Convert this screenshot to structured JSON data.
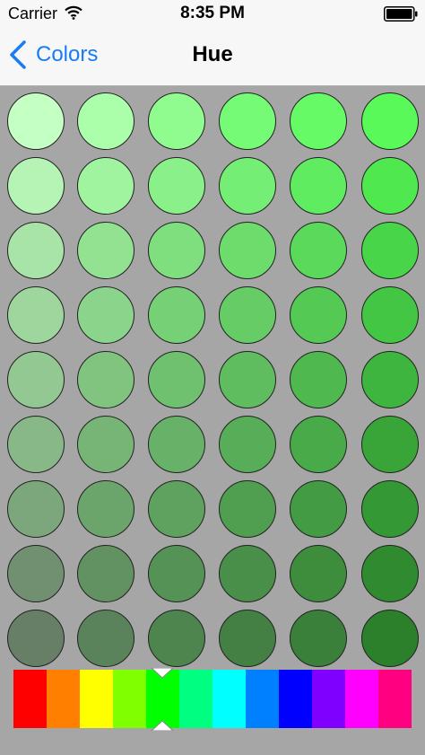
{
  "status_bar": {
    "carrier": "Carrier",
    "time": "8:35 PM",
    "wifi_icon": "wifi-icon",
    "battery_icon": "battery-icon"
  },
  "nav": {
    "back_label": "Colors",
    "back_icon": "chevron-left-icon",
    "title": "Hue",
    "accent": "#1a7cf5"
  },
  "swatch_rows": [
    [
      "#c4ffc4",
      "#abffab",
      "#90fc90",
      "#75fb75",
      "#66fa66",
      "#58f958"
    ],
    [
      "#b6f4b6",
      "#a0f4a0",
      "#8af18a",
      "#74ee74",
      "#60ec60",
      "#4fe94f"
    ],
    [
      "#a8e4a8",
      "#92e292",
      "#7fdf7f",
      "#6ddc6d",
      "#5ad95a",
      "#49d549"
    ],
    [
      "#9ed69e",
      "#8bd48b",
      "#76d076",
      "#66cd66",
      "#54ca54",
      "#43c643"
    ],
    [
      "#93c893",
      "#80c480",
      "#6fc06f",
      "#5fbd5f",
      "#4fb94f",
      "#3eb53e"
    ],
    [
      "#88b788",
      "#77b577",
      "#68b168",
      "#58ad58",
      "#49aa49",
      "#39a539"
    ],
    [
      "#7ca77c",
      "#6ca56c",
      "#5fa25f",
      "#509f50",
      "#439b43",
      "#349834"
    ],
    [
      "#718f71",
      "#629162",
      "#559255",
      "#498e49",
      "#3d8d3d",
      "#308a30"
    ],
    [
      "#677e67",
      "#5b835b",
      "#4e844e",
      "#448044",
      "#3a803a",
      "#2c802c"
    ]
  ],
  "hue_bar": {
    "colors": [
      "#ff0000",
      "#ff7f00",
      "#ffff00",
      "#7fff00",
      "#00ff00",
      "#00ff80",
      "#00ffff",
      "#0080ff",
      "#0000ff",
      "#8000ff",
      "#ff00ff",
      "#ff0080"
    ],
    "selected_index": 4,
    "marker_icon": "hue-selector-icon"
  }
}
